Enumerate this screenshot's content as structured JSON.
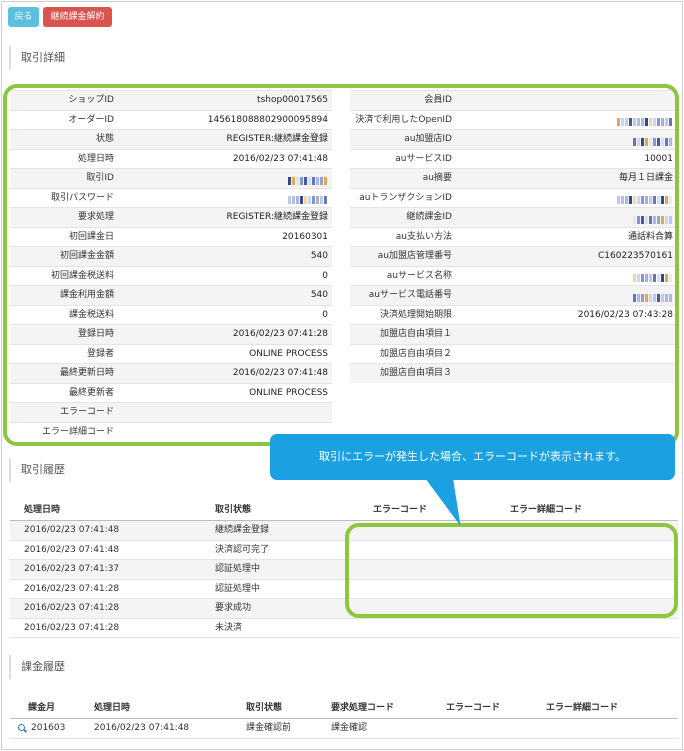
{
  "buttons": {
    "back": "戻る",
    "cancel_continuous": "継続課金解約"
  },
  "sections": {
    "detail": "取引詳細",
    "history": "取引履歴",
    "billing": "課金履歴"
  },
  "detail_left": [
    {
      "k": "ショップID",
      "v": "tshop00017565"
    },
    {
      "k": "オーダーID",
      "v": "14561808880290009589​4"
    },
    {
      "k": "状態",
      "v": "REGISTER:継続課金登録"
    },
    {
      "k": "処理日時",
      "v": "2016/02/23 07:41:48"
    },
    {
      "k": "取引ID",
      "v": "",
      "masked": true
    },
    {
      "k": "取引パスワード",
      "v": "",
      "masked": true
    },
    {
      "k": "要求処理",
      "v": "REGISTER:継続課金登録"
    },
    {
      "k": "初回課金日",
      "v": "20160301"
    },
    {
      "k": "初回課金金額",
      "v": "540"
    },
    {
      "k": "初回課金税送料",
      "v": "0"
    },
    {
      "k": "課金利用金額",
      "v": "540"
    },
    {
      "k": "課金税送料",
      "v": "0"
    },
    {
      "k": "登録日時",
      "v": "2016/02/23 07:41:28"
    },
    {
      "k": "登録者",
      "v": "ONLINE PROCESS"
    },
    {
      "k": "最終更新日時",
      "v": "2016/02/23 07:41:48"
    },
    {
      "k": "最終更新者",
      "v": "ONLINE PROCESS"
    },
    {
      "k": "エラーコード",
      "v": ""
    },
    {
      "k": "エラー詳細コード",
      "v": ""
    }
  ],
  "detail_right": [
    {
      "k": "会員ID",
      "v": ""
    },
    {
      "k": "決済で利用したOpenID",
      "v": "",
      "masked": true
    },
    {
      "k": "au加盟店ID",
      "v": "",
      "masked": true
    },
    {
      "k": "auサービスID",
      "v": "10001"
    },
    {
      "k": "au摘要",
      "v": "毎月１日課金"
    },
    {
      "k": "auトランザクションID",
      "v": "",
      "masked": true
    },
    {
      "k": "継続課金ID",
      "v": "",
      "masked": true
    },
    {
      "k": "au支払い方法",
      "v": "通話料合算"
    },
    {
      "k": "au加盟店管理番号",
      "v": "C160223570161"
    },
    {
      "k": "auサービス名称",
      "v": "",
      "masked": true
    },
    {
      "k": "auサービス電話番号",
      "v": "",
      "masked": true
    },
    {
      "k": "決済処理開始期限",
      "v": "2016/02/23 07:43:28"
    },
    {
      "k": "加盟店自由項目１",
      "v": ""
    },
    {
      "k": "加盟店自由項目２",
      "v": ""
    },
    {
      "k": "加盟店自由項目３",
      "v": ""
    }
  ],
  "callout": "取引にエラーが発生した場合、エラーコードが表示されます。",
  "history": {
    "headers": [
      "処理日時",
      "取引状態",
      "エラーコード",
      "エラー詳細コード"
    ],
    "rows": [
      [
        "2016/02/23 07:41:48",
        "継続課金登録",
        "",
        ""
      ],
      [
        "2016/02/23 07:41:48",
        "決済認可完了",
        "",
        ""
      ],
      [
        "2016/02/23 07:41:37",
        "認証処理中",
        "",
        ""
      ],
      [
        "2016/02/23 07:41:28",
        "認証処理中",
        "",
        ""
      ],
      [
        "2016/02/23 07:41:28",
        "要求成功",
        "",
        ""
      ],
      [
        "2016/02/23 07:41:28",
        "未決済",
        "",
        ""
      ]
    ]
  },
  "billing": {
    "headers": [
      "課金月",
      "処理日時",
      "取引状態",
      "要求処理コード",
      "エラーコード",
      "エラー詳細コード"
    ],
    "rows": [
      [
        "201603",
        "2016/02/23 07:41:48",
        "課金確認前",
        "課金確認",
        "",
        ""
      ]
    ]
  },
  "colors": {
    "highlight": "#8cc63f",
    "callout": "#1ba1e2",
    "back_button": "#5bc0de",
    "cancel_button": "#d9534f"
  }
}
